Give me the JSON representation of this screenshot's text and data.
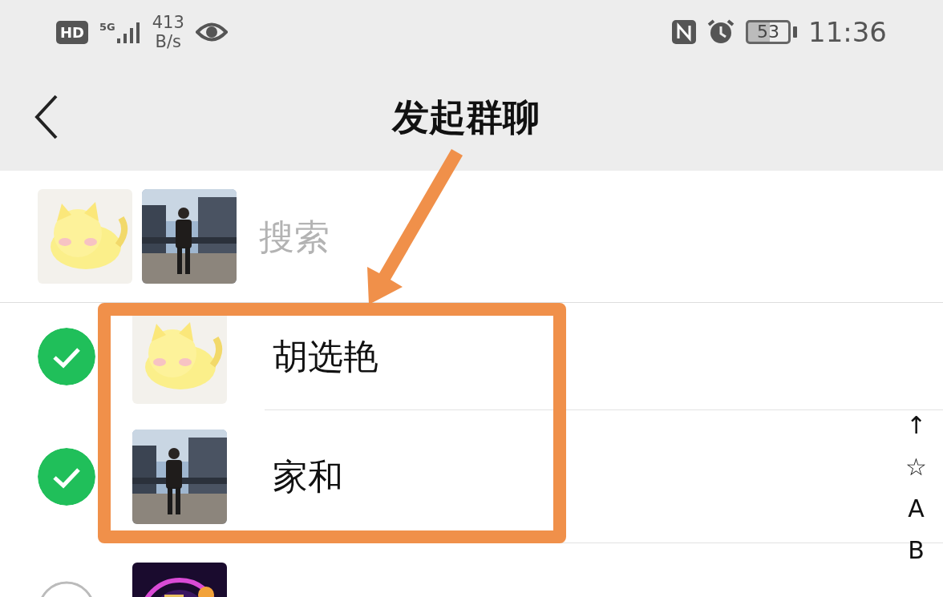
{
  "status_bar": {
    "hd": "HD",
    "network": "5G",
    "speed": "413",
    "speed_unit": "B/s",
    "battery": "53",
    "time": "11:36"
  },
  "header": {
    "title": "发起群聊"
  },
  "search": {
    "placeholder": "搜索"
  },
  "contacts": [
    {
      "name": "胡选艳",
      "checked": true
    },
    {
      "name": "家和",
      "checked": true
    },
    {
      "checked": false
    }
  ],
  "index": [
    "↑",
    "☆",
    "A",
    "B"
  ]
}
